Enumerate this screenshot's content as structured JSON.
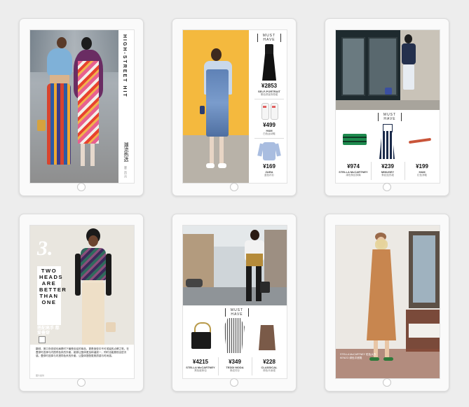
{
  "tablets": [
    {
      "id": 1,
      "vertical_title": "HIGH-STREET HIT",
      "vertical_cn": "潮流热选",
      "page_number": "第二页 月"
    },
    {
      "id": 2,
      "must_have": "MUST HAVE",
      "products": [
        {
          "price": "¥2853",
          "brand": "SELF-PORTRAIT",
          "note": "黑色拼接背带裙"
        },
        {
          "price": "¥499",
          "brand": "H&M",
          "note": "白色运动鞋"
        },
        {
          "price": "¥169",
          "brand": "ZARA",
          "note": "蓝色衬衫"
        }
      ]
    },
    {
      "id": 3,
      "must_have": "MUST HAVE",
      "products": [
        {
          "price": "¥974",
          "brand": "STELLA McCARTNEY",
          "note": "绿色条纹抹胸"
        },
        {
          "price": "¥239",
          "brand": "MINUSEY",
          "note": "条纹连衣裙"
        },
        {
          "price": "¥199",
          "brand": "H&M",
          "note": "红色凉鞋"
        }
      ]
    },
    {
      "id": 4,
      "number": "3.",
      "headline": "TWO HEADS ARE BETTER THAN ONE",
      "headline_cn": "搭配高手 都爱叠穿",
      "caption": "翻领、宽口衣领或坎肩是时下最受欢迎的单品，更是造型中不可或缺的点睛之笔。在叠穿时选择与内搭同色系的外套，能够让整体更加和谐统一，同时也能展现出层次感。叠穿时选择与内搭同色系的外套，让整体搭配更具质感与时尚感。",
      "caption_note": "图片提供"
    },
    {
      "id": 5,
      "must_have": "MUST HAVE",
      "products": [
        {
          "price": "¥4215",
          "brand": "STELLA McCARTNEY",
          "note": "黑色链条包"
        },
        {
          "price": "¥349",
          "brand": "TEDDI MODA",
          "note": "条纹衬衫"
        },
        {
          "price": "¥228",
          "brand": "CLASSICAL",
          "note": "棕色半身裙"
        }
      ]
    },
    {
      "id": 6,
      "caption": "STELLA McCARTNEY 驼色大衣 KENZO 绿色平底鞋"
    }
  ],
  "colors": {
    "background": "#ededed",
    "tablet_frame": "#fafafa",
    "accent_yellow": "#f4b93e",
    "coat_camel": "#c8864f"
  }
}
